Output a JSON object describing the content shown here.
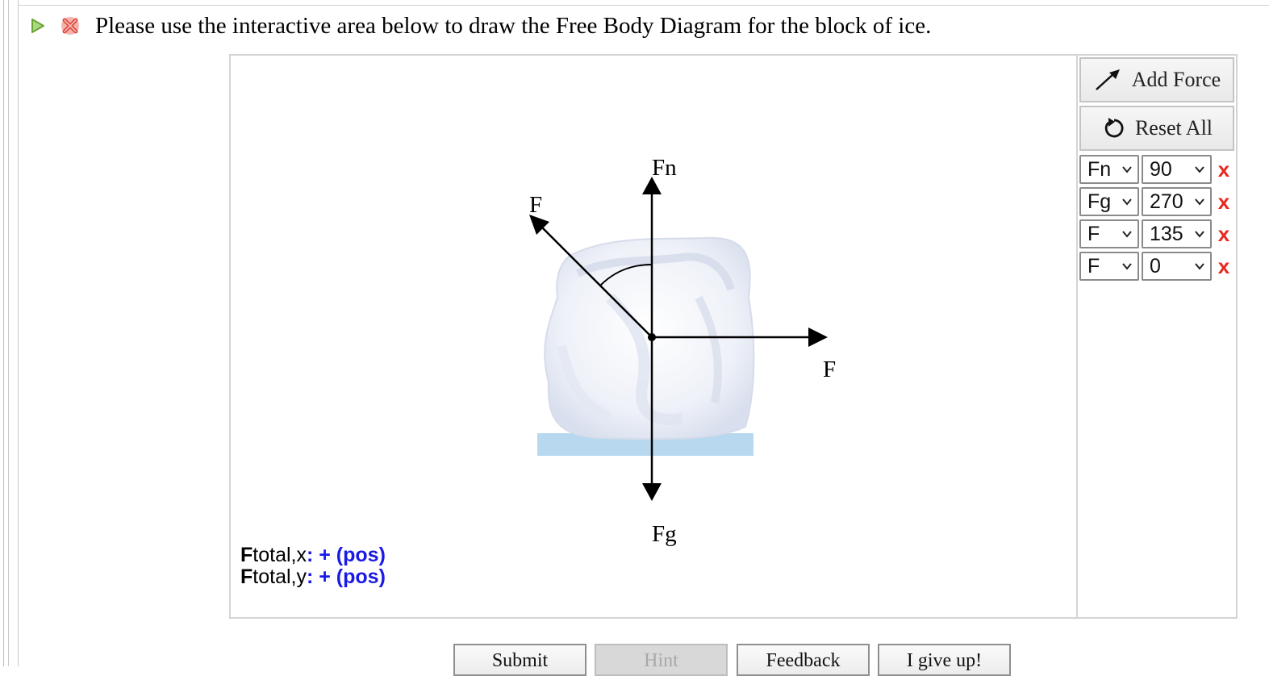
{
  "prompt": {
    "text": "Please use the interactive area below to draw the Free Body Diagram for the block of ice."
  },
  "panel": {
    "add_force_label": "Add Force",
    "reset_all_label": "Reset All"
  },
  "forces": [
    {
      "name": "Fn",
      "angle": "90"
    },
    {
      "name": "Fg",
      "angle": "270"
    },
    {
      "name": "F",
      "angle": "135"
    },
    {
      "name": "F",
      "angle": "0"
    }
  ],
  "delete_symbol": "x",
  "diagram": {
    "labels": {
      "fn": "Fn",
      "fg": "Fg",
      "f_diag": "F",
      "f_right": "F"
    }
  },
  "totals": {
    "x": {
      "symbol": "F",
      "sub": "total,x",
      "value": ": + (pos)"
    },
    "y": {
      "symbol": "F",
      "sub": "total,y",
      "value": ": + (pos)"
    }
  },
  "bottom_buttons": {
    "submit": "Submit",
    "hint": "Hint",
    "feedback": "Feedback",
    "give_up": "I give up!"
  },
  "colors": {
    "status_green": "#7bbf3f",
    "status_red": "#e04a3f",
    "delete_red": "#e8281e",
    "total_blue": "#1a1ae6",
    "ice_floor": "#b8d8ef"
  }
}
